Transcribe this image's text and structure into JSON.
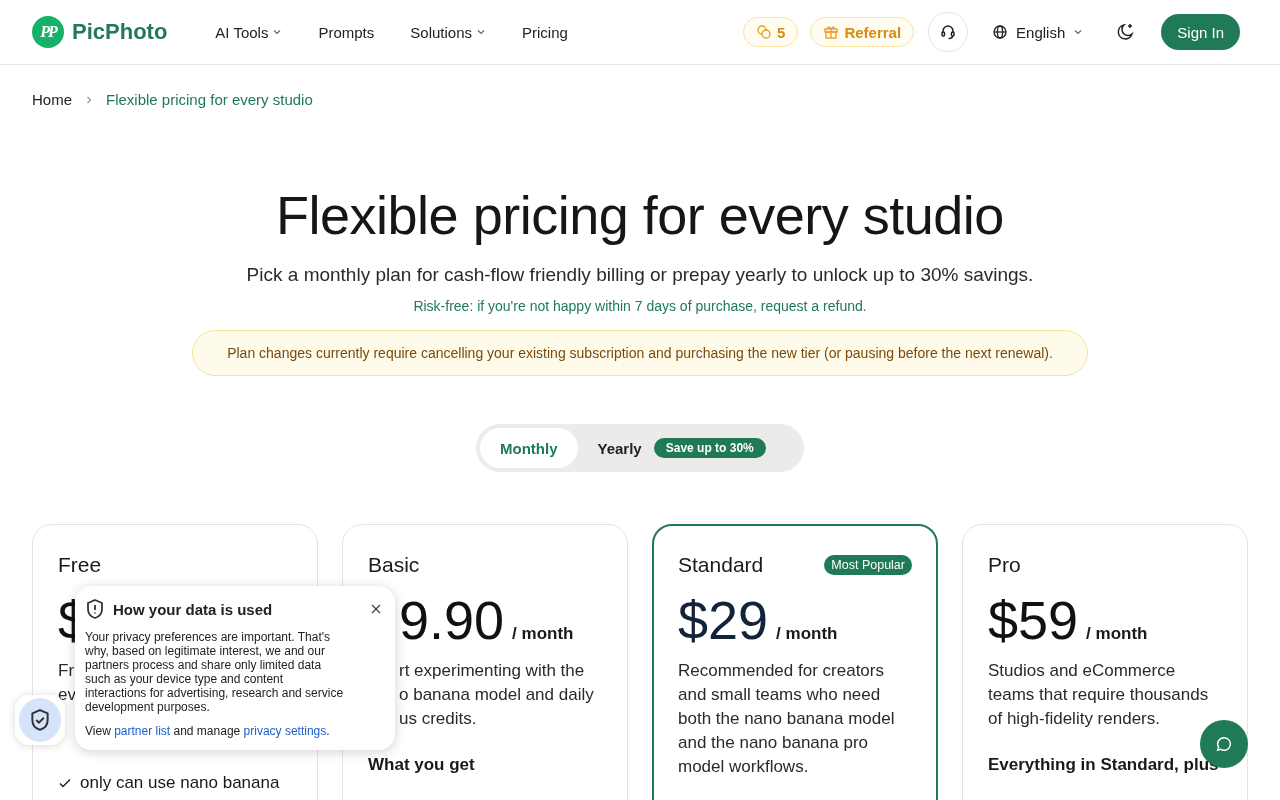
{
  "header": {
    "logo_mark": "PP",
    "logo_name": "PicPhoto",
    "nav": [
      {
        "label": "AI Tools",
        "dropdown": true
      },
      {
        "label": "Prompts",
        "dropdown": false
      },
      {
        "label": "Solutions",
        "dropdown": true
      },
      {
        "label": "Pricing",
        "dropdown": false
      }
    ],
    "credits": "5",
    "referral": "Referral",
    "language": "English",
    "sign_in": "Sign In"
  },
  "breadcrumb": [
    "Home",
    "Flexible pricing for every studio"
  ],
  "hero": {
    "title": "Flexible pricing for every studio",
    "subtitle": "Pick a monthly plan for cash-flow friendly billing or prepay yearly to unlock up to 30% savings.",
    "guarantee": "Risk-free: if you're not happy within 7 days of purchase, request a refund.",
    "notice": "Plan changes currently require cancelling your existing subscription and purchasing the new tier (or pausing before the next renewal)."
  },
  "billing_toggle": [
    {
      "label": "Monthly",
      "selected": true
    },
    {
      "label": "Yearly",
      "selected": false,
      "badge": "Save up to 30%"
    }
  ],
  "plans": [
    {
      "kind": "plain",
      "name": "Free",
      "featured": false,
      "price": "$",
      "description_lines": [
        "Fr",
        "ev"
      ],
      "features": [
        "only can use nano banana"
      ]
    },
    {
      "kind": "partly-covered",
      "name": "Basic",
      "featured": false,
      "price": "9.90",
      "period": "/ month",
      "description_lines": [
        "rt experimenting with the",
        "o banana model and daily",
        "us credits."
      ],
      "features_heading": "What you get"
    },
    {
      "kind": "plain",
      "name": "Standard",
      "featured": true,
      "badge": "Most Popular",
      "price": "$29",
      "period": "/ month",
      "description": "Recommended for creators and small teams who need both the nano banana model and the nano banana pro model workflows."
    },
    {
      "kind": "plain",
      "name": "Pro",
      "featured": false,
      "price": "$59",
      "period": "/ month",
      "description": "Studios and eCommerce teams that require thousands of high-fidelity renders.",
      "features_heading": "Everything in Standard, plus"
    }
  ],
  "privacy_popup": {
    "title": "How your data is used",
    "body": "Your privacy preferences are important. That's why, based on legitimate interest, we and our partners process and share only limited data such as your device type and content interactions for advertising, research and service development purposes.",
    "footer": [
      {
        "kind": "text",
        "text": "View "
      },
      {
        "kind": "link",
        "text": "partner list"
      },
      {
        "kind": "text",
        "text": " and manage "
      },
      {
        "kind": "link",
        "text": "privacy settings"
      },
      {
        "kind": "text",
        "text": "."
      }
    ]
  }
}
